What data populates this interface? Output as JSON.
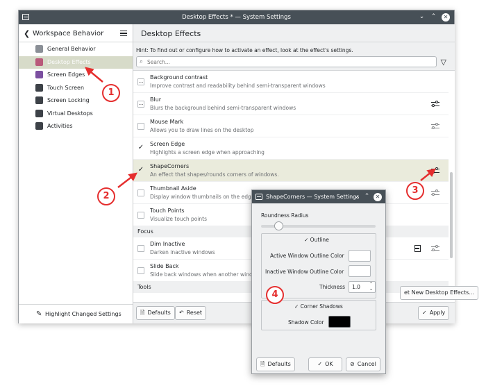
{
  "window": {
    "title": "Desktop Effects * — System Settings",
    "controls": [
      "⌄",
      "⌃",
      "✕"
    ]
  },
  "sidebar": {
    "header": "Workspace Behavior",
    "items": [
      {
        "label": "General Behavior",
        "icon": "general-behavior-icon",
        "color": "#8a8f96"
      },
      {
        "label": "Desktop Effects",
        "icon": "desktop-effects-icon",
        "color": "#b9597b",
        "active": true
      },
      {
        "label": "Screen Edges",
        "icon": "screen-edges-icon",
        "color": "#7b4fa0"
      },
      {
        "label": "Touch Screen",
        "icon": "touch-screen-icon",
        "color": "#3d4248"
      },
      {
        "label": "Screen Locking",
        "icon": "screen-locking-icon",
        "color": "#3d4248"
      },
      {
        "label": "Virtual Desktops",
        "icon": "virtual-desktops-icon",
        "color": "#3d4248"
      },
      {
        "label": "Activities",
        "icon": "activities-icon",
        "color": "#3d4248"
      }
    ],
    "footer_label": "Highlight Changed Settings"
  },
  "main": {
    "title": "Desktop Effects",
    "hint": "Hint: To find out or configure how to activate an effect, look at the effect's settings.",
    "search_placeholder": "Search...",
    "effects": [
      {
        "name": "Background contrast",
        "desc": "Improve contrast and readability behind semi-transparent windows",
        "state": "partial",
        "config": false
      },
      {
        "name": "Blur",
        "desc": "Blurs the background behind semi-transparent windows",
        "state": "partial",
        "config": true,
        "config_dim": false
      },
      {
        "name": "Mouse Mark",
        "desc": "Allows you to draw lines on the desktop",
        "state": "unchecked",
        "config": true,
        "config_dim": true
      },
      {
        "name": "Screen Edge",
        "desc": "Highlights a screen edge when approaching",
        "state": "checked",
        "config": false
      },
      {
        "name": "ShapeCorners",
        "desc": "An effect that shapes/rounds corners of windows.",
        "state": "checked",
        "config": true,
        "config_dim": false,
        "highlighted": true
      },
      {
        "name": "Thumbnail Aside",
        "desc": "Display window thumbnails on the edge",
        "state": "unchecked",
        "config": true,
        "config_dim": true
      },
      {
        "name": "Touch Points",
        "desc": "Visualize touch points",
        "state": "unchecked",
        "config": false
      }
    ],
    "group_focus": "Focus",
    "focus_effects": [
      {
        "name": "Dim Inactive",
        "desc": "Darken inactive windows",
        "state": "unchecked",
        "config": true,
        "config_dim": true,
        "film": true
      },
      {
        "name": "Slide Back",
        "desc": "Slide back windows when another wind",
        "state": "unchecked",
        "config": false
      }
    ],
    "group_tools": "Tools",
    "get_new_label": "et New Desktop Effects...",
    "defaults_label": "Defaults",
    "reset_label": "Reset",
    "apply_label": "Apply"
  },
  "dialog": {
    "title": "ShapeCorners — System Settings",
    "roundness_label": "Roundness Radius",
    "roundness_value": 0.15,
    "outline_label": "Outline",
    "active_outline_label": "Active Window Outline Color",
    "inactive_outline_label": "Inactive Window Outline Color",
    "thickness_label": "Thickness",
    "thickness_value": "1.0",
    "corner_shadows_label": "Corner Shadows",
    "shadow_color_label": "Shadow Color",
    "defaults_label": "Defaults",
    "ok_label": "OK",
    "cancel_label": "Cancel"
  },
  "annotations": [
    "1",
    "2",
    "3",
    "4"
  ],
  "colors": {
    "accent": "#e52e2e",
    "titlebar": "#475057",
    "highlight": "#eaebdc"
  }
}
